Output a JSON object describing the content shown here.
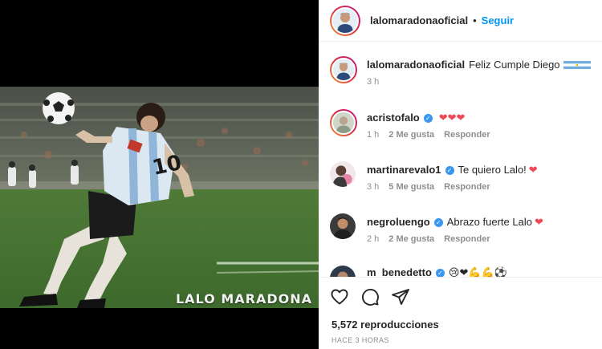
{
  "media": {
    "watermark": "LALO MARADONA"
  },
  "header": {
    "username": "lalomaradonaoficial",
    "separator": "•",
    "follow_label": "Seguir"
  },
  "caption": {
    "username": "lalomaradonaoficial",
    "text": "Feliz Cumple Diego",
    "time": "3 h",
    "flag_icon": "argentina-flag-icon"
  },
  "comments": [
    {
      "username": "acristofalo",
      "verified": true,
      "text": "",
      "emoji": "❤❤❤",
      "time": "1 h",
      "likes": "2 Me gusta",
      "reply": "Responder"
    },
    {
      "username": "martinarevalo1",
      "verified": true,
      "text": "Te quiero Lalo!",
      "emoji": "❤",
      "time": "3 h",
      "likes": "5 Me gusta",
      "reply": "Responder"
    },
    {
      "username": "negroluengo",
      "verified": true,
      "text": "Abrazo fuerte Lalo",
      "emoji": "❤",
      "time": "2 h",
      "likes": "2 Me gusta",
      "reply": "Responder"
    },
    {
      "username": "m_benedetto",
      "verified": true,
      "text": "",
      "emoji": "😢❤💪💪⚽",
      "time": "",
      "likes": "",
      "reply": ""
    }
  ],
  "actions": {
    "like_icon": "heart-icon",
    "comment_icon": "comment-icon",
    "share_icon": "share-icon"
  },
  "stats": {
    "views": "5,572 reproducciones",
    "posted": "HACE 3 HORAS"
  },
  "colors": {
    "link_blue": "#0095f6",
    "heart_red": "#ed4956",
    "verified_blue": "#3897f0",
    "muted": "#8e8e8e"
  }
}
